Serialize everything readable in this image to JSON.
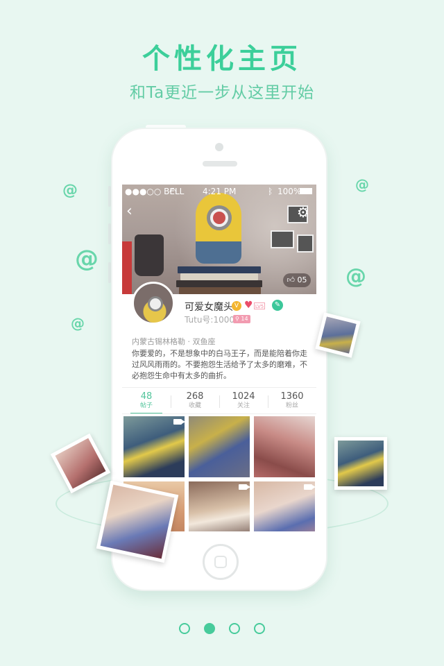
{
  "header": {
    "title": "个性化主页",
    "subtitle": "和Ta更近一步从这里开始"
  },
  "status_bar": {
    "carrier": "●●●○○ BELL",
    "time": "4:21 PM",
    "battery": "100%"
  },
  "cover": {
    "likes": "05"
  },
  "profile": {
    "name": "可爱女魔头",
    "verified_badge": "V",
    "level": "LV5",
    "tutu_id": "Tutu号:100023",
    "location_badge": "14",
    "place": "内蒙古锡林格勒 · 双鱼座",
    "bio": "你要爱的，不是想象中的白马王子，而是能陪着你走过风风雨雨的。不要抱怨生活给予了太多的磨难，不必抱怨生命中有太多的曲折。"
  },
  "stats": [
    {
      "num": "48",
      "label": "帖子"
    },
    {
      "num": "268",
      "label": "收藏"
    },
    {
      "num": "1024",
      "label": "关注"
    },
    {
      "num": "1360",
      "label": "粉丝"
    }
  ],
  "pager": {
    "count": 4,
    "active_index": 1
  },
  "colors": {
    "accent": "#47cb9b",
    "background": "#e8f7f1"
  }
}
